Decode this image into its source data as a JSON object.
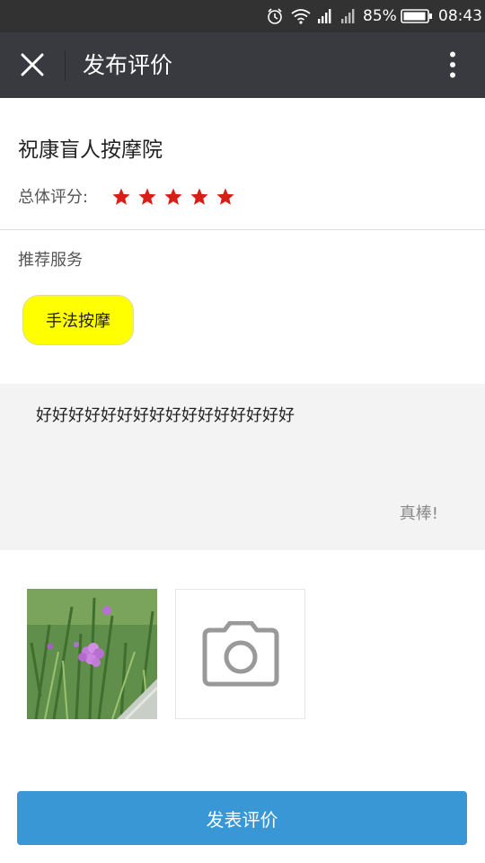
{
  "status_bar": {
    "icons": [
      "alarm-icon",
      "wifi-icon",
      "signal-icon",
      "signal-icon",
      "battery-icon"
    ],
    "battery_percent": "85%",
    "time": "08:43"
  },
  "title_bar": {
    "close_icon": "close-icon",
    "title": "发布评价",
    "more_icon": "more-vertical-icon"
  },
  "shop": {
    "name": "祝康盲人按摩院",
    "rating_label": "总体评分:",
    "rating": 5,
    "rating_max": 5,
    "star_color": "#d91e18"
  },
  "services": {
    "label": "推荐服务",
    "tags": [
      {
        "label": "手法按摩",
        "color": "#ffff00"
      }
    ]
  },
  "review": {
    "text": "好好好好好好好好好好好好好好好好",
    "hint": "真棒!"
  },
  "photos": {
    "thumbnails": [
      "flower-photo"
    ],
    "add_icon": "camera-icon"
  },
  "submit": {
    "label": "发表评价",
    "color": "#3a97d6"
  }
}
